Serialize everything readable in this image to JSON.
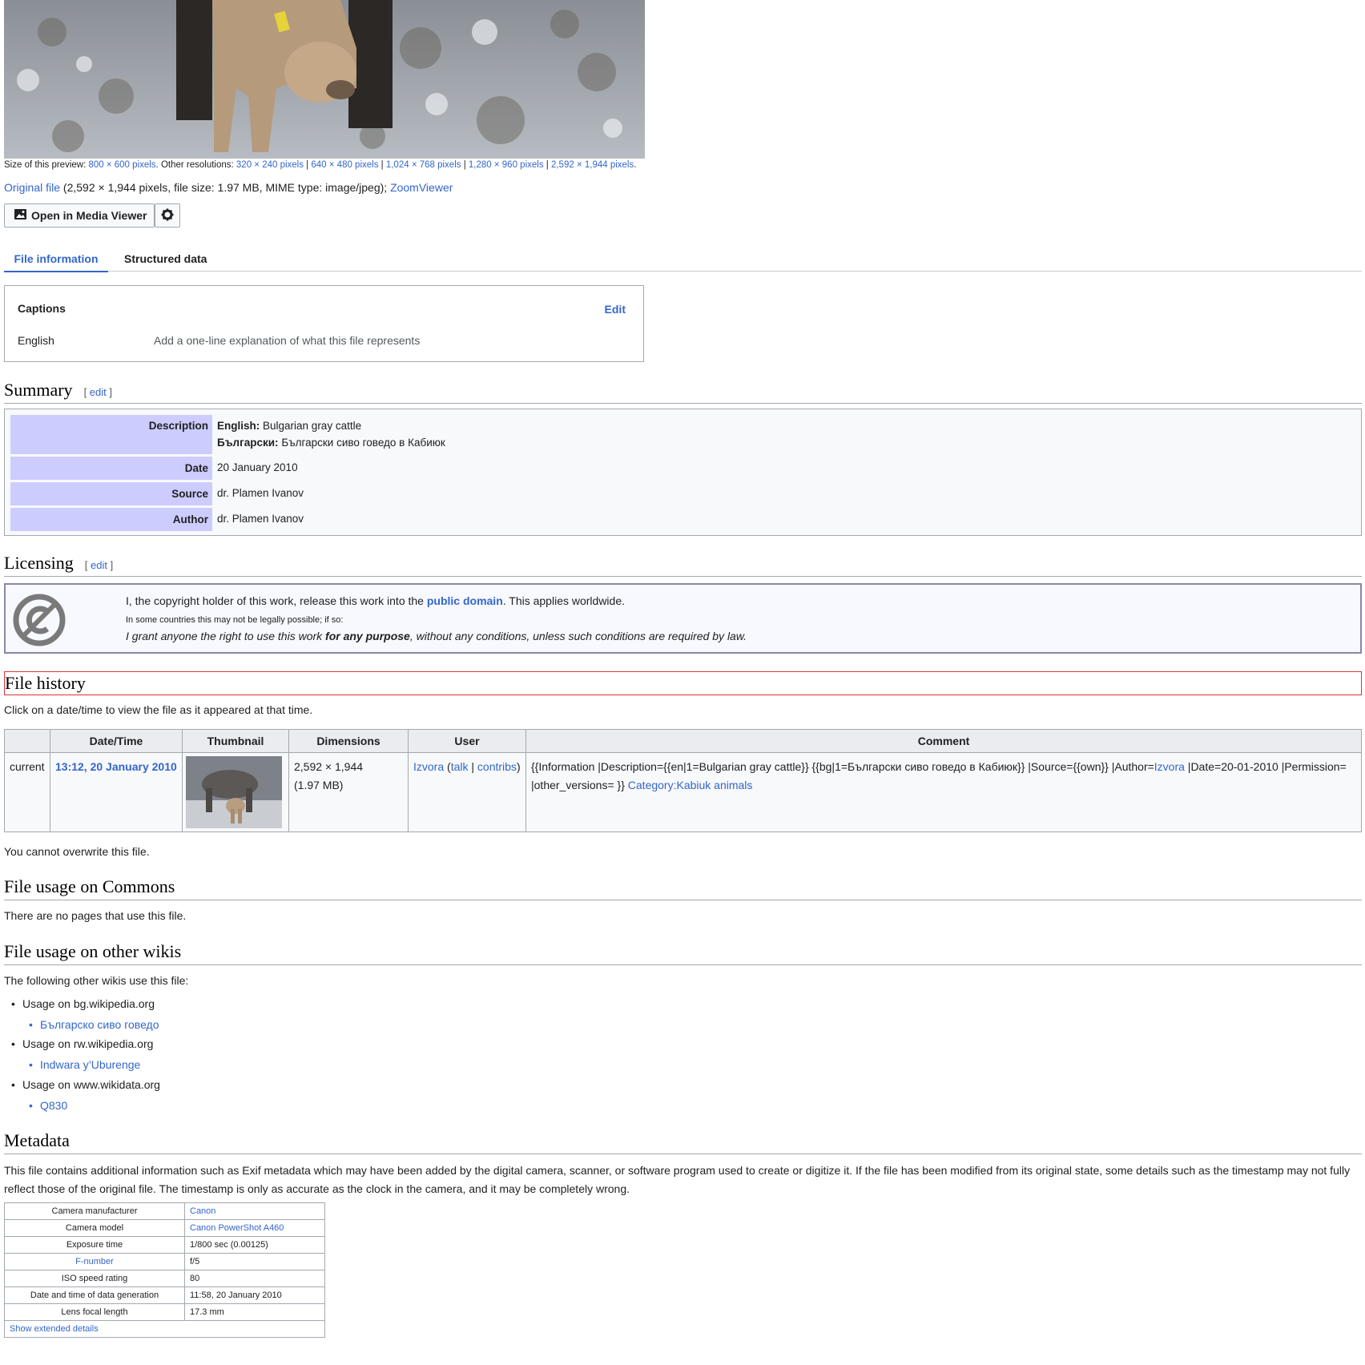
{
  "preview": {
    "size_label": "Size of this preview:",
    "size_link": "800 × 600 pixels",
    "other_label": "Other resolutions:",
    "resolutions": [
      "320 × 240 pixels",
      "640 × 480 pixels",
      "1,024 × 768 pixels",
      "1,280 × 960 pixels",
      "2,592 × 1,944 pixels"
    ]
  },
  "original": {
    "link": "Original file",
    "info": "(2,592 × 1,944 pixels, file size: 1.97 MB, MIME type: image/jpeg);",
    "zoom": "ZoomViewer"
  },
  "media_viewer": {
    "label": "Open in Media Viewer"
  },
  "tabs": [
    {
      "label": "File information",
      "active": true
    },
    {
      "label": "Structured data",
      "active": false
    }
  ],
  "captions": {
    "title": "Captions",
    "edit": "Edit",
    "language": "English",
    "placeholder": "Add a one-line explanation of what this file represents"
  },
  "summary": {
    "heading": "Summary",
    "edit": "edit",
    "rows": {
      "description_label": "Description",
      "desc_en_lang": "English:",
      "desc_en_text": "Bulgarian gray cattle",
      "desc_bg_lang": "Български:",
      "desc_bg_text": "Български сиво говедо в Кабиюк",
      "date_label": "Date",
      "date_value": "20 January 2010",
      "source_label": "Source",
      "source_value": "dr. Plamen Ivanov",
      "author_label": "Author",
      "author_value": "dr. Plamen Ivanov"
    }
  },
  "licensing": {
    "heading": "Licensing",
    "edit": "edit",
    "line1_pre": "I, the copyright holder of this work, release this work into the",
    "line1_link": "public domain",
    "line1_post": ". This applies worldwide.",
    "line2": "In some countries this may not be legally possible; if so:",
    "line3_pre": "I grant anyone the right to use this work",
    "line3_bold": "for any purpose",
    "line3_post": ", without any conditions, unless such conditions are required by law."
  },
  "file_history": {
    "heading": "File history",
    "intro": "Click on a date/time to view the file as it appeared at that time.",
    "columns": [
      "",
      "Date/Time",
      "Thumbnail",
      "Dimensions",
      "User",
      "Comment"
    ],
    "row": {
      "status": "current",
      "datetime": "13:12, 20 January 2010",
      "dimensions": "2,592 × 1,944",
      "size": "(1.97 MB)",
      "user": "Izvora",
      "talk": "talk",
      "contribs": "contribs",
      "comment_pre": "{{Information |Description={{en|1=Bulgarian gray cattle}} {{bg|1=Български сиво говедо в Кабиюк}} |Source={{own}} |Author=",
      "comment_user": "Izvora",
      "comment_post": " |Date=20-01-2010 |Permission= |other_versions= }}",
      "comment_category": "Category:Kabiuk animals"
    },
    "overwrite": "You cannot overwrite this file."
  },
  "usage_commons": {
    "heading": "File usage on Commons",
    "text": "There are no pages that use this file."
  },
  "usage_other": {
    "heading": "File usage on other wikis",
    "intro": "The following other wikis use this file:",
    "items": [
      {
        "wiki": "Usage on bg.wikipedia.org",
        "page": "Българско сиво говедо"
      },
      {
        "wiki": "Usage on rw.wikipedia.org",
        "page": "Indwara y’Uburenge"
      },
      {
        "wiki": "Usage on www.wikidata.org",
        "page": "Q830"
      }
    ]
  },
  "metadata": {
    "heading": "Metadata",
    "text": "This file contains additional information such as Exif metadata which may have been added by the digital camera, scanner, or software program used to create or digitize it. If the file has been modified from its original state, some details such as the timestamp may not fully reflect those of the original file. The timestamp is only as accurate as the clock in the camera, and it may be completely wrong.",
    "rows": [
      {
        "k": "Camera manufacturer",
        "v": "Canon",
        "k_link": false,
        "v_link": true
      },
      {
        "k": "Camera model",
        "v": "Canon PowerShot A460",
        "k_link": false,
        "v_link": true
      },
      {
        "k": "Exposure time",
        "v": "1/800 sec (0.00125)",
        "k_link": false,
        "v_link": false
      },
      {
        "k": "F-number",
        "v": "f/5",
        "k_link": true,
        "v_link": false
      },
      {
        "k": "ISO speed rating",
        "v": "80",
        "k_link": false,
        "v_link": false
      },
      {
        "k": "Date and time of data generation",
        "v": "11:58, 20 January 2010",
        "k_link": false,
        "v_link": false
      },
      {
        "k": "Lens focal length",
        "v": "17.3 mm",
        "k_link": false,
        "v_link": false
      }
    ],
    "show_extended": "Show extended details"
  }
}
